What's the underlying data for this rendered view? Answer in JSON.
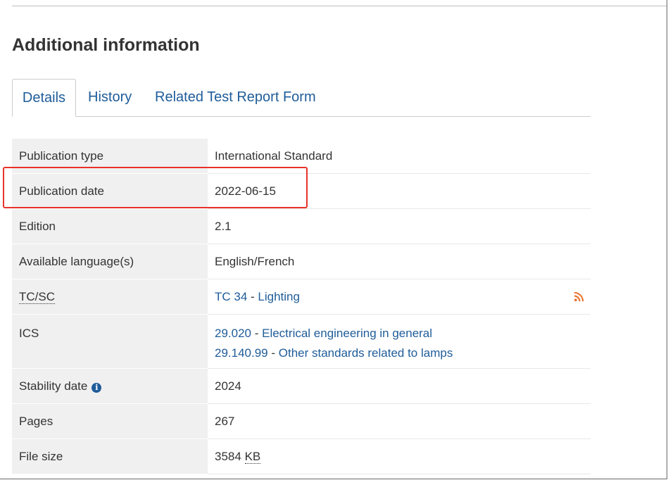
{
  "section": {
    "heading": "Additional information"
  },
  "tabs": [
    {
      "label": "Details",
      "active": true
    },
    {
      "label": "History",
      "active": false
    },
    {
      "label": "Related Test Report Form",
      "active": false
    }
  ],
  "details": {
    "publication_type": {
      "label": "Publication type",
      "value": "International Standard"
    },
    "publication_date": {
      "label": "Publication date",
      "value": "2022-06-15"
    },
    "edition": {
      "label": "Edition",
      "value": "2.1"
    },
    "languages": {
      "label": "Available language(s)",
      "value": "English/French"
    },
    "tcsc": {
      "label": "TC/SC",
      "code": "TC 34",
      "separator": " - ",
      "name": "Lighting",
      "icon": "rss-feed-icon"
    },
    "ics": {
      "label": "ICS",
      "entries": [
        {
          "code": "29.020",
          "separator": " - ",
          "name": "Electrical engineering in general"
        },
        {
          "code": "29.140.99",
          "separator": " - ",
          "name": "Other standards related to lamps"
        }
      ]
    },
    "stability_date": {
      "label": "Stability date",
      "value": "2024",
      "icon": "info-icon",
      "icon_glyph": "i"
    },
    "pages": {
      "label": "Pages",
      "value": "267"
    },
    "file_size": {
      "label": "File size",
      "value": "3584",
      "unit": "KB"
    }
  },
  "colors": {
    "link": "#1f5c99",
    "highlight": "#e8322a",
    "rss": "#e8712a",
    "label_bg": "#f0f0f0"
  }
}
